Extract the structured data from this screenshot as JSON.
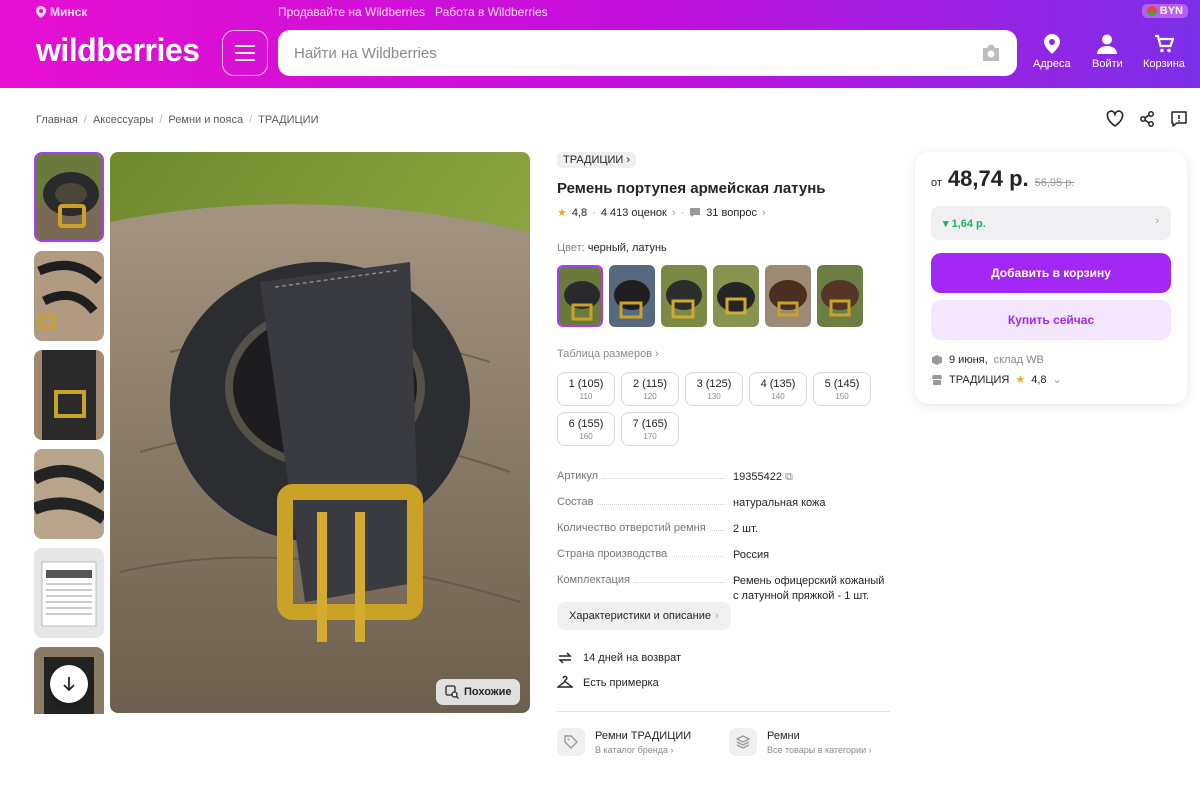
{
  "header": {
    "location": "Минск",
    "links": [
      "Продавайте на Wildberries",
      "Работа в Wildberries"
    ],
    "currency": "BYN",
    "logo": "wildberries",
    "search_placeholder": "Найти на Wildberries",
    "nav": {
      "addresses": "Адреса",
      "login": "Войти",
      "cart": "Корзина"
    }
  },
  "breadcrumbs": [
    "Главная",
    "Аксессуары",
    "Ремни и пояса",
    "ТРАДИЦИИ"
  ],
  "product": {
    "brand": "ТРАДИЦИИ",
    "title": "Ремень портупея армейская латунь",
    "rating": "4,8",
    "reviews": "4 413 оценок",
    "questions": "31 вопрос",
    "color_label": "Цвет:",
    "color_value": "черный, латунь",
    "size_table": "Таблица размеров",
    "sizes": [
      {
        "main": "1 (105)",
        "sub": "110"
      },
      {
        "main": "2 (115)",
        "sub": "120"
      },
      {
        "main": "3 (125)",
        "sub": "130"
      },
      {
        "main": "4 (135)",
        "sub": "140"
      },
      {
        "main": "5 (145)",
        "sub": "150"
      },
      {
        "main": "6 (155)",
        "sub": "160"
      },
      {
        "main": "7 (165)",
        "sub": "170"
      }
    ],
    "specs": [
      {
        "k": "Артикул",
        "v": "19355422"
      },
      {
        "k": "Состав",
        "v": "натуральная кожа"
      },
      {
        "k": "Количество отверстий ремня",
        "v": "2 шт."
      },
      {
        "k": "Страна производства",
        "v": "Россия"
      },
      {
        "k": "Комплектация",
        "v": "Ремень офицерский кожаный с латунной пряжкой - 1 шт."
      }
    ],
    "char_button": "Характеристики и описание",
    "return_text": "14 дней на возврат",
    "fitting_text": "Есть примерка",
    "similar": "Похожие",
    "brand_link": {
      "title": "Ремни ТРАДИЦИИ",
      "sub": "В каталог бренда"
    },
    "category_link": {
      "title": "Ремни",
      "sub": "Все товары в категории"
    }
  },
  "buy": {
    "from": "от",
    "price": "48,74 р.",
    "old_price": "56,95 р.",
    "discount": "▾ 1,64 р.",
    "add_to_cart": "Добавить в корзину",
    "buy_now": "Купить сейчас",
    "delivery_date": "9 июня,",
    "delivery_wh": "склад WB",
    "seller": "ТРАДИЦИЯ",
    "seller_rating": "4,8"
  },
  "colors": {
    "accent": "#a226f4",
    "green": "#14b65b"
  }
}
